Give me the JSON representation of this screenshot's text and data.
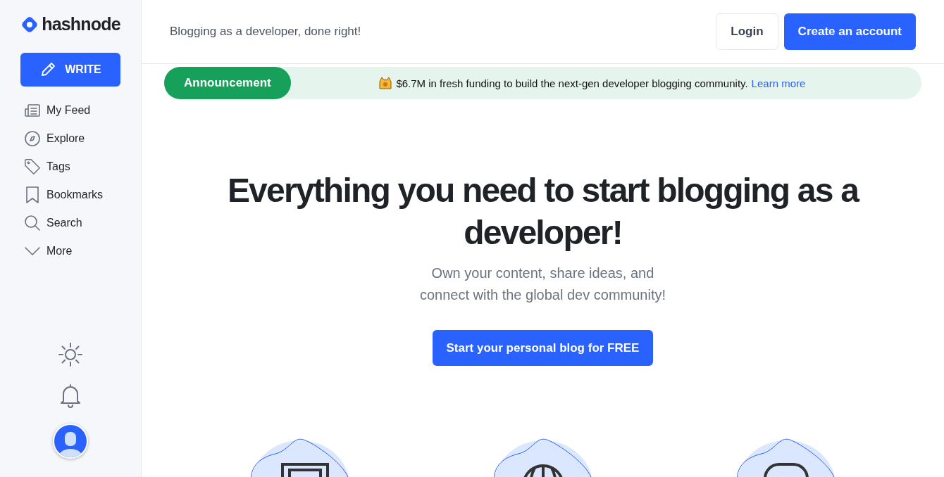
{
  "brand": {
    "name": "hashnode"
  },
  "sidebar": {
    "write_button": "WRITE",
    "items": [
      {
        "label": "My Feed"
      },
      {
        "label": "Explore"
      },
      {
        "label": "Tags"
      },
      {
        "label": "Bookmarks"
      },
      {
        "label": "Search"
      },
      {
        "label": "More"
      }
    ]
  },
  "header": {
    "tagline": "Blogging as a developer, done right!",
    "buttons": [
      {
        "label": "Login",
        "kind": "outline"
      },
      {
        "label": "Create an account",
        "kind": "primary"
      }
    ]
  },
  "announcement": {
    "badge": "Announcement",
    "text": "$6.7M in fresh funding to build the next-gen developer blogging community.",
    "link": "Learn more"
  },
  "hero": {
    "title": "Everything you need to start blogging as a developer!",
    "subtitle_lines": [
      "Own your content, share ideas, and",
      "connect with the global dev community!"
    ],
    "cta": "Start your personal blog for FREE"
  }
}
